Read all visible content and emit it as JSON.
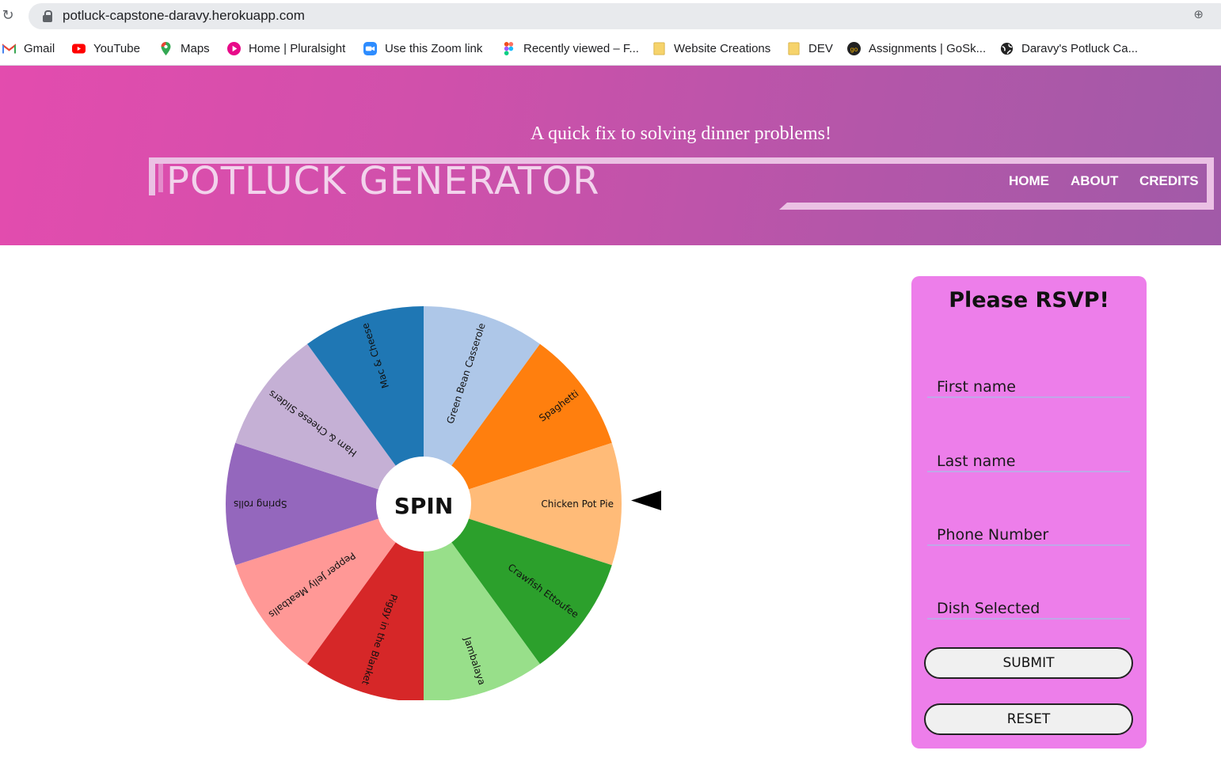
{
  "browser": {
    "url": "potluck-capstone-daravy.herokuapp.com",
    "bookmarks": [
      {
        "label": "Gmail",
        "icon": "gmail-icon",
        "color": "#ea4335"
      },
      {
        "label": "YouTube",
        "icon": "youtube-icon",
        "color": "#ff0000"
      },
      {
        "label": "Maps",
        "icon": "maps-icon",
        "color": "#34a853"
      },
      {
        "label": "Home | Pluralsight",
        "icon": "pluralsight-icon",
        "color": "#e80a89"
      },
      {
        "label": "Use this Zoom link",
        "icon": "zoom-icon",
        "color": "#2d8cff"
      },
      {
        "label": "Recently viewed – F...",
        "icon": "figma-icon",
        "color": "#a259ff"
      },
      {
        "label": "Website Creations",
        "icon": "folder-icon",
        "color": "#f6d36b"
      },
      {
        "label": "DEV",
        "icon": "folder-icon",
        "color": "#f6d36b"
      },
      {
        "label": "Assignments | GoSk...",
        "icon": "goskills-icon",
        "color": "#222222"
      },
      {
        "label": "Daravy's Potluck Ca...",
        "icon": "globe-icon",
        "color": "#222222"
      }
    ]
  },
  "header": {
    "tagline": "A quick fix to solving dinner problems!",
    "title": "POTLUCK GENERATOR",
    "nav": [
      "HOME",
      "ABOUT",
      "CREDITS"
    ]
  },
  "wheel": {
    "center_label": "SPIN",
    "slices": [
      {
        "label": "Green Bean Casserole",
        "color": "#aec7e8"
      },
      {
        "label": "Spaghetti",
        "color": "#ff7f0e"
      },
      {
        "label": "Chicken Pot Pie",
        "color": "#ffbb78"
      },
      {
        "label": "Crawfish Ettoufee",
        "color": "#2ca02c"
      },
      {
        "label": "Jambalaya",
        "color": "#98df8a"
      },
      {
        "label": "Piggy in the Blanket",
        "color": "#d62728"
      },
      {
        "label": "Pepper Jelly Meatballs",
        "color": "#ff9896"
      },
      {
        "label": "Spring rolls",
        "color": "#9467bd"
      },
      {
        "label": "Ham & Cheese Sliders",
        "color": "#c5b0d5"
      },
      {
        "label": "Mac & Cheese",
        "color": "#1f77b4"
      }
    ],
    "selected": "Chicken Pot Pie"
  },
  "rsvp": {
    "title": "Please RSVP!",
    "fields": {
      "first_name": "First name",
      "last_name": "Last name",
      "phone": "Phone Number",
      "dish": "Dish Selected"
    },
    "submit_label": "SUBMIT",
    "reset_label": "RESET"
  }
}
